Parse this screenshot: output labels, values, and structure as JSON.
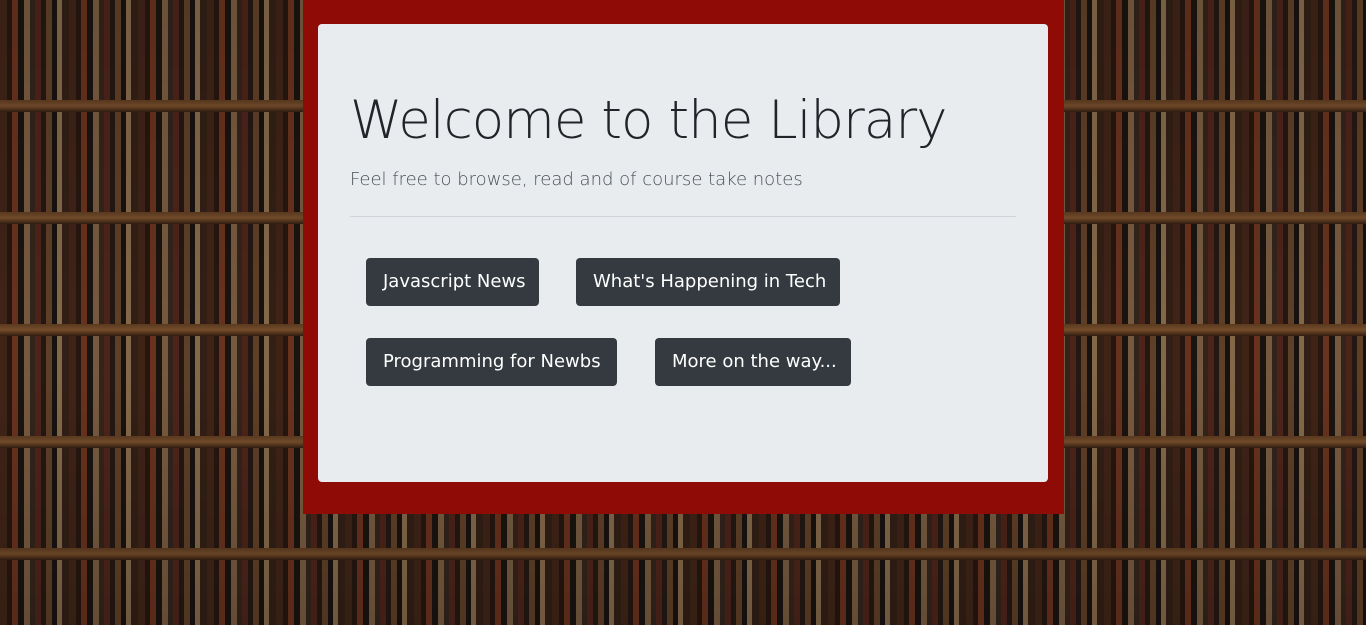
{
  "jumbotron": {
    "title": "Welcome to the Library",
    "lead": "Feel free to browse, read and of course take notes"
  },
  "buttons": [
    {
      "label": "Javascript News"
    },
    {
      "label": "What's Happening in Tech"
    },
    {
      "label": "Programming for Newbs"
    },
    {
      "label": "More on the way..."
    }
  ],
  "colors": {
    "frame": "#8e0b06",
    "card": "#e9ecef",
    "button": "#343a40"
  }
}
